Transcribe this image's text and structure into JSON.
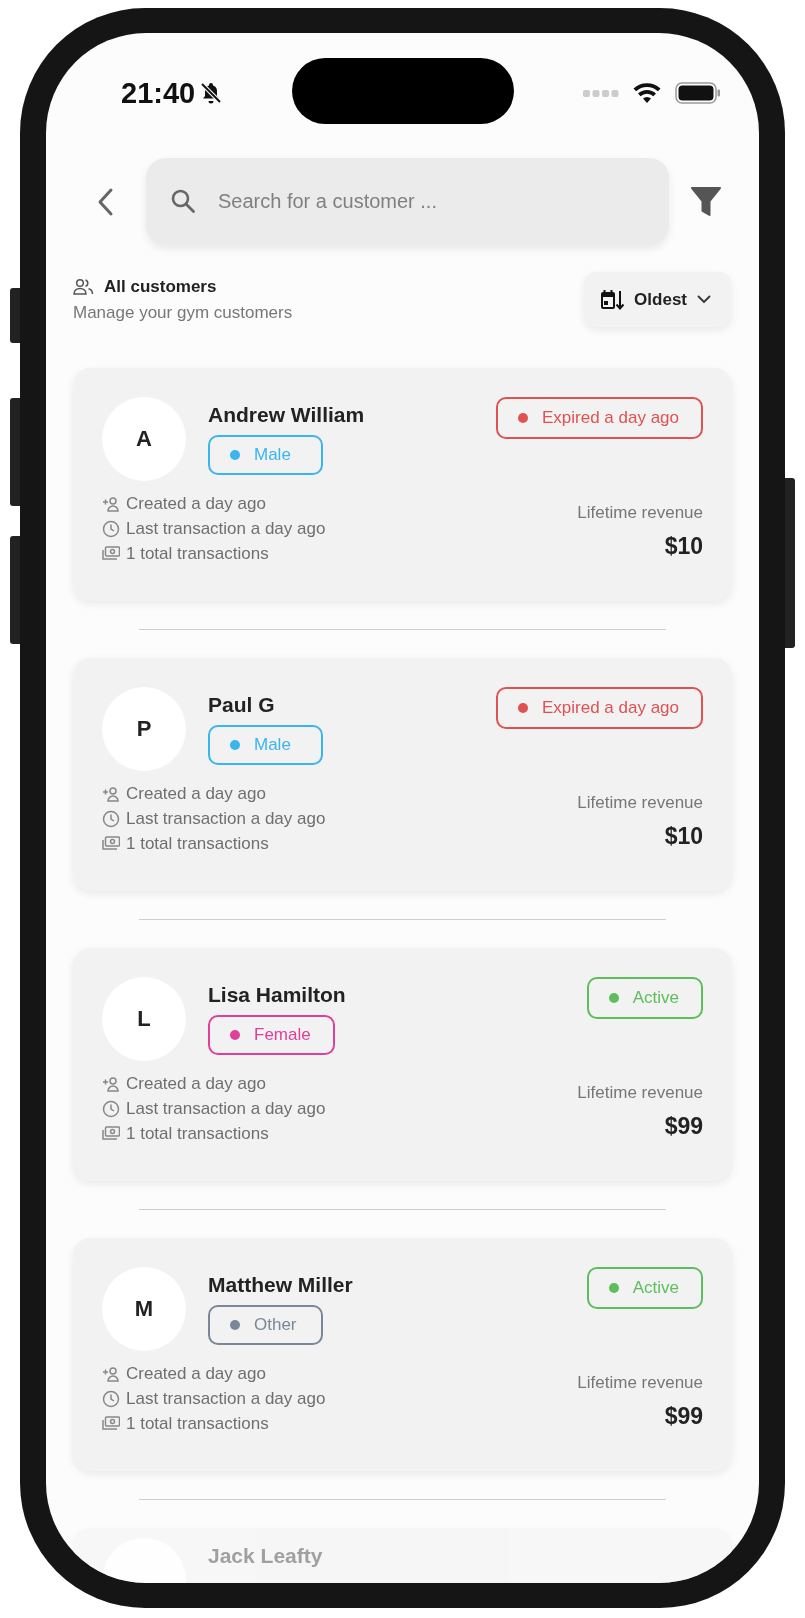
{
  "status_bar": {
    "time": "21:40"
  },
  "search": {
    "placeholder": "Search for a customer ..."
  },
  "header": {
    "title": "All customers",
    "subtitle": "Manage your gym customers",
    "sort": "Oldest"
  },
  "customers": [
    {
      "kind": "full",
      "initial": "A",
      "name": "Andrew William",
      "gender": {
        "label": "Male",
        "color": "#3ab5ee"
      },
      "status": {
        "label": "Expired a day ago",
        "color": "#e05252"
      },
      "created": "Created a day ago",
      "last_transaction": "Last transaction a day ago",
      "transactions": "1 total transactions",
      "revenue_label": "Lifetime revenue",
      "revenue": "$10"
    },
    {
      "kind": "full",
      "initial": "P",
      "name": "Paul G",
      "gender": {
        "label": "Male",
        "color": "#3ab5ee"
      },
      "status": {
        "label": "Expired a day ago",
        "color": "#e05252"
      },
      "created": "Created a day ago",
      "last_transaction": "Last transaction a day ago",
      "transactions": "1 total transactions",
      "revenue_label": "Lifetime revenue",
      "revenue": "$10"
    },
    {
      "kind": "full",
      "initial": "L",
      "name": "Lisa Hamilton",
      "gender": {
        "label": "Female",
        "color": "#e0409a"
      },
      "status": {
        "label": "Active",
        "color": "#5cbf5c"
      },
      "created": "Created a day ago",
      "last_transaction": "Last transaction a day ago",
      "transactions": "1 total transactions",
      "revenue_label": "Lifetime revenue",
      "revenue": "$99"
    },
    {
      "kind": "full",
      "initial": "M",
      "name": "Matthew Miller",
      "gender": {
        "label": "Other",
        "color": "#7a8799"
      },
      "status": {
        "label": "Active",
        "color": "#5cbf5c"
      },
      "created": "Created a day ago",
      "last_transaction": "Last transaction a day ago",
      "transactions": "1 total transactions",
      "revenue_label": "Lifetime revenue",
      "revenue": "$99"
    },
    {
      "kind": "faded",
      "name": "Jack Leafty"
    }
  ]
}
